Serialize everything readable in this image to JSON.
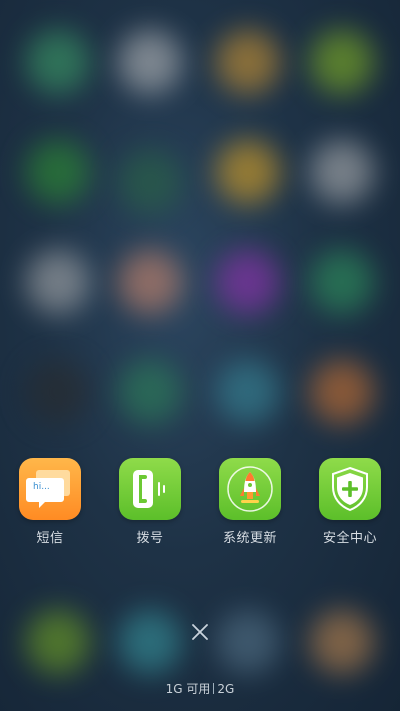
{
  "apps": [
    {
      "label": "短信",
      "icon": "message-bubble-icon",
      "color": "#ff9a30"
    },
    {
      "label": "拨号",
      "icon": "phone-handset-icon",
      "color": "#6cc934"
    },
    {
      "label": "系统更新",
      "icon": "rocket-icon",
      "color": "#6cc934"
    },
    {
      "label": "安全中心",
      "icon": "shield-plus-icon",
      "color": "#6cc934"
    }
  ],
  "sms_bubble_text": "hi...",
  "close_icon": "close-icon",
  "memory": {
    "available": "1G 可用",
    "total": "2G"
  },
  "colors": {
    "orange": "#ff9a30",
    "green": "#6cc934",
    "label": "#d7dde3"
  }
}
